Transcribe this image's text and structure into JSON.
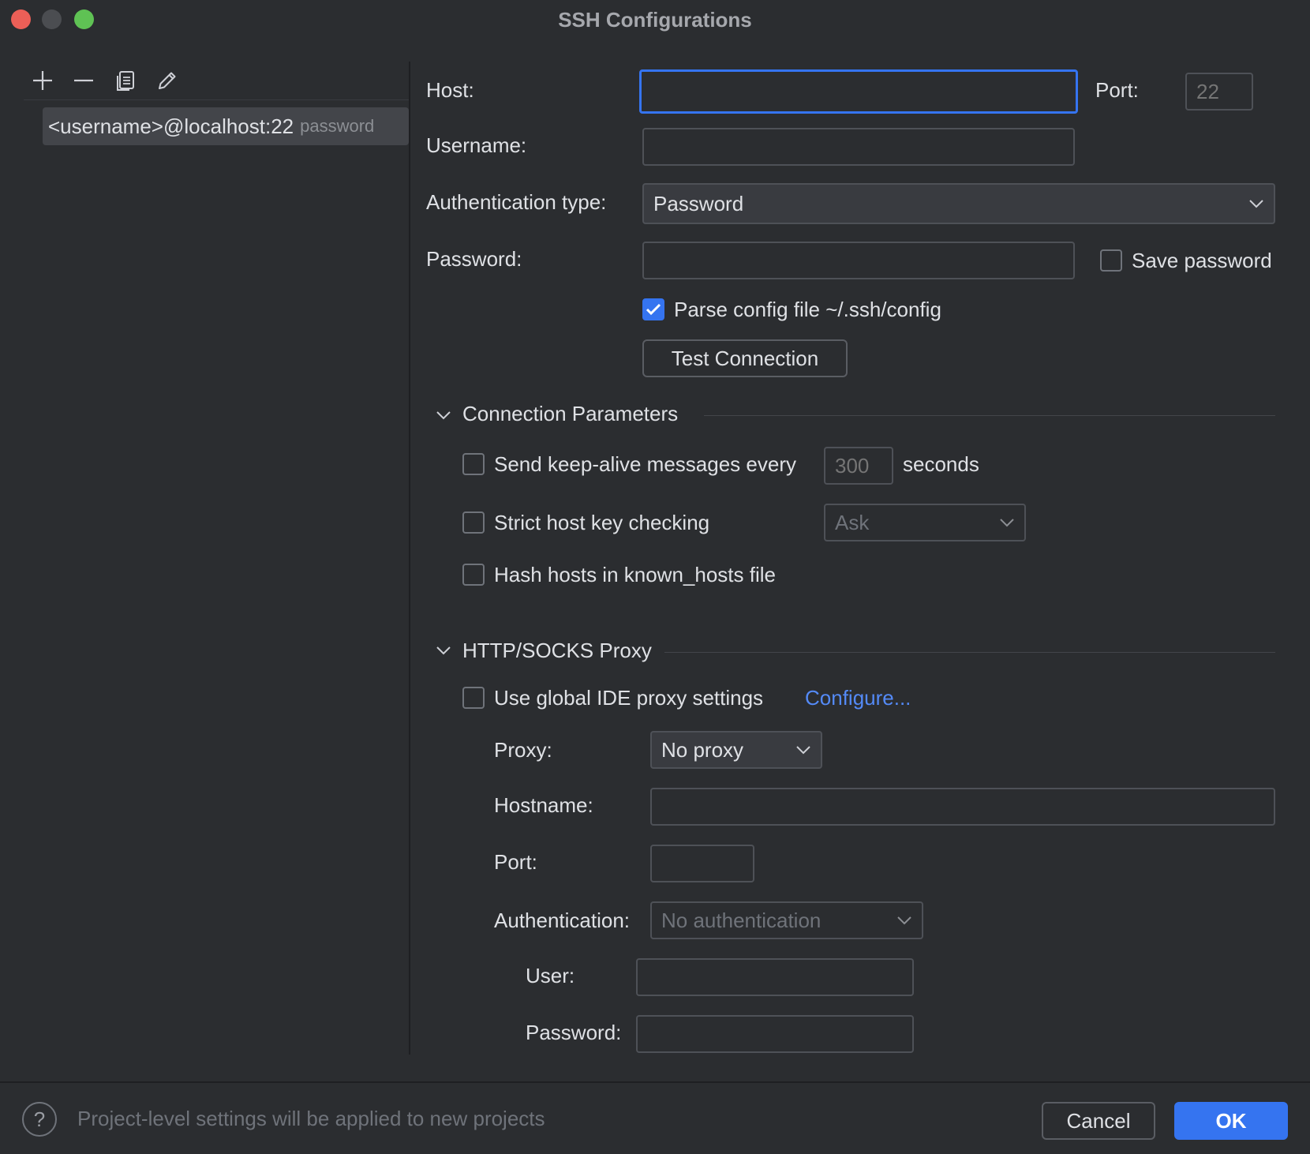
{
  "window": {
    "title": "SSH Configurations"
  },
  "sidebar": {
    "toolbar": [
      {
        "name": "add-icon"
      },
      {
        "name": "remove-icon"
      },
      {
        "name": "copy-icon"
      },
      {
        "name": "edit-icon"
      }
    ],
    "items": [
      {
        "label": "<username>@localhost:22",
        "auth": "password"
      }
    ]
  },
  "form": {
    "host_label": "Host:",
    "host_value": "",
    "port_label": "Port:",
    "port_placeholder": "22",
    "username_label": "Username:",
    "username_value": "",
    "auth_type_label": "Authentication type:",
    "auth_type_value": "Password",
    "password_label": "Password:",
    "password_value": "",
    "save_password_label": "Save password",
    "save_password_checked": false,
    "parse_config_label": "Parse config file ~/.ssh/config",
    "parse_config_checked": true,
    "test_connection_label": "Test Connection"
  },
  "connection_params": {
    "section_title": "Connection Parameters",
    "keepalive_label": "Send keep-alive messages every",
    "keepalive_placeholder": "300",
    "keepalive_unit": "seconds",
    "strict_host_label": "Strict host key checking",
    "strict_host_value": "Ask",
    "hash_hosts_label": "Hash hosts in known_hosts file"
  },
  "proxy": {
    "section_title": "HTTP/SOCKS Proxy",
    "use_global_label": "Use global IDE proxy settings",
    "configure_link": "Configure...",
    "proxy_label": "Proxy:",
    "proxy_value": "No proxy",
    "hostname_label": "Hostname:",
    "port_label": "Port:",
    "authentication_label": "Authentication:",
    "authentication_value": "No authentication",
    "user_label": "User:",
    "password_label": "Password:"
  },
  "footer": {
    "help_glyph": "?",
    "note": "Project-level settings will be applied to new projects",
    "cancel_label": "Cancel",
    "ok_label": "OK"
  },
  "colors": {
    "background": "#2b2d30",
    "accent": "#3574f0",
    "link": "#548af7",
    "close": "#ec5f57",
    "maximize": "#5fc254"
  }
}
